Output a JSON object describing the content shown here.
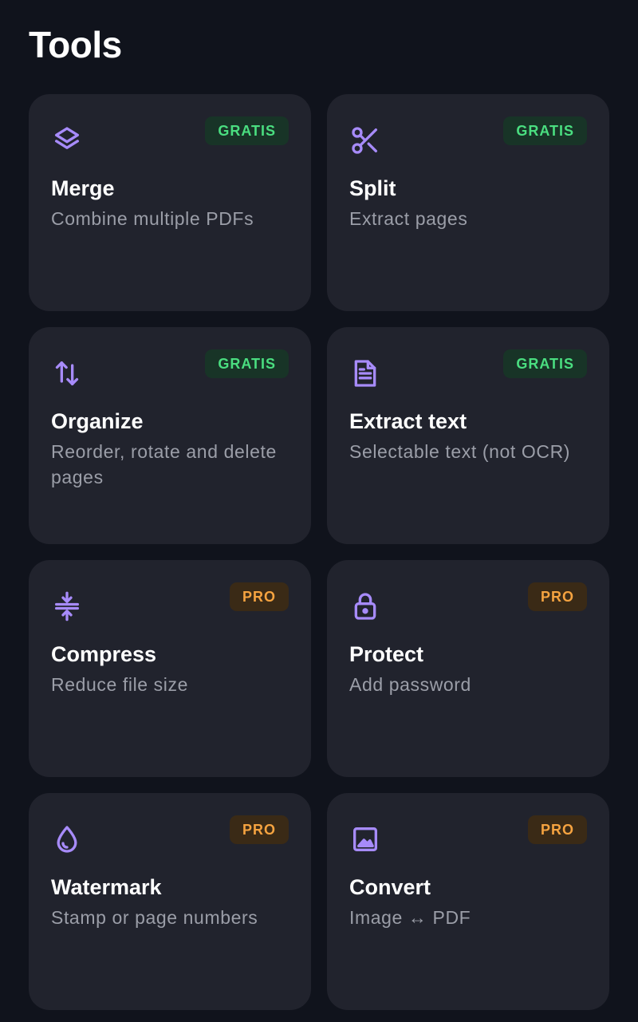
{
  "header": {
    "title": "Tools"
  },
  "colors": {
    "background": "#10131c",
    "card": "#21232d",
    "accent_icon": "#a78bfa",
    "free_badge_bg": "#183427",
    "free_badge_text": "#4ade80",
    "pro_badge_bg": "#3a2a16",
    "pro_badge_text": "#f5a340"
  },
  "tools": [
    {
      "title": "Merge",
      "description": "Combine multiple PDFs",
      "badge": "GRATIS",
      "tier": "free",
      "icon": "layers-icon"
    },
    {
      "title": "Split",
      "description": "Extract pages",
      "badge": "GRATIS",
      "tier": "free",
      "icon": "scissors-icon"
    },
    {
      "title": "Organize",
      "description": "Reorder, rotate and delete pages",
      "badge": "GRATIS",
      "tier": "free",
      "icon": "reorder-arrows-icon"
    },
    {
      "title": "Extract text",
      "description": "Selectable text (not OCR)",
      "badge": "GRATIS",
      "tier": "free",
      "icon": "document-text-icon"
    },
    {
      "title": "Compress",
      "description": "Reduce file size",
      "badge": "PRO",
      "tier": "pro",
      "icon": "compress-icon"
    },
    {
      "title": "Protect",
      "description": "Add password",
      "badge": "PRO",
      "tier": "pro",
      "icon": "lock-icon"
    },
    {
      "title": "Watermark",
      "description": "Stamp or page numbers",
      "badge": "PRO",
      "tier": "pro",
      "icon": "droplet-icon"
    },
    {
      "title": "Convert",
      "description": "Image ↔ PDF",
      "badge": "PRO",
      "tier": "pro",
      "icon": "image-icon"
    }
  ]
}
